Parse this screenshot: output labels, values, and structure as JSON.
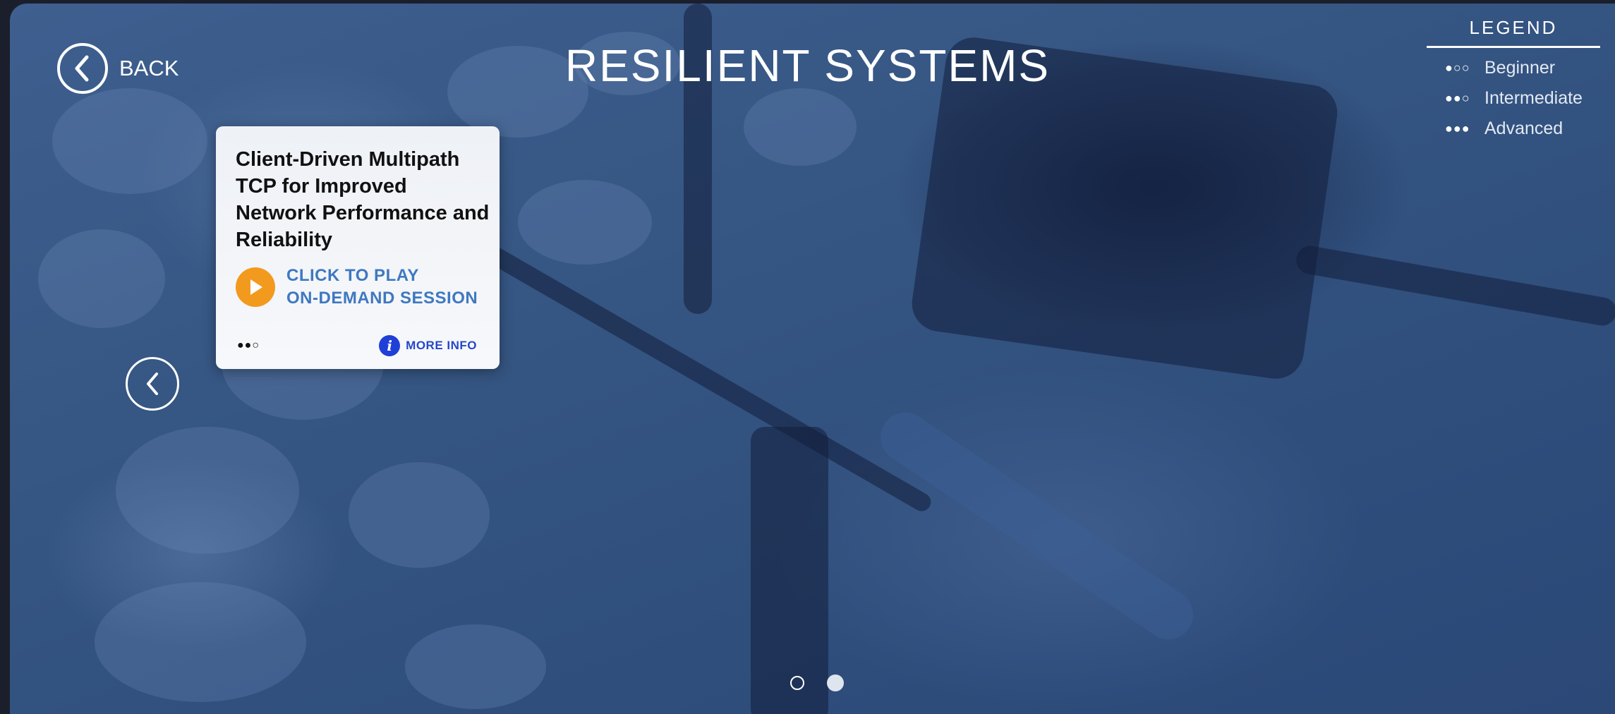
{
  "header": {
    "title": "RESILIENT SYSTEMS"
  },
  "nav": {
    "back_label": "BACK"
  },
  "legend": {
    "title": "LEGEND",
    "items": [
      {
        "dots": "●○○",
        "label": "Beginner"
      },
      {
        "dots": "●●○",
        "label": "Intermediate"
      },
      {
        "dots": "●●●",
        "label": "Advanced"
      }
    ]
  },
  "card": {
    "title": "Client-Driven Multipath TCP for Improved Network Performance and Reliability",
    "play_line1": "CLICK TO PLAY",
    "play_line2": "ON-DEMAND SESSION",
    "level_dots": "●●○",
    "more_info": "MORE INFO",
    "icons": {
      "play": "play-icon",
      "info": "info-icon"
    },
    "colors": {
      "play_bg": "#f29a1e",
      "play_text": "#3f78c0",
      "info_bg": "#1f3fd6"
    }
  },
  "carousel": {
    "page_count": 2,
    "current_page": 2
  }
}
